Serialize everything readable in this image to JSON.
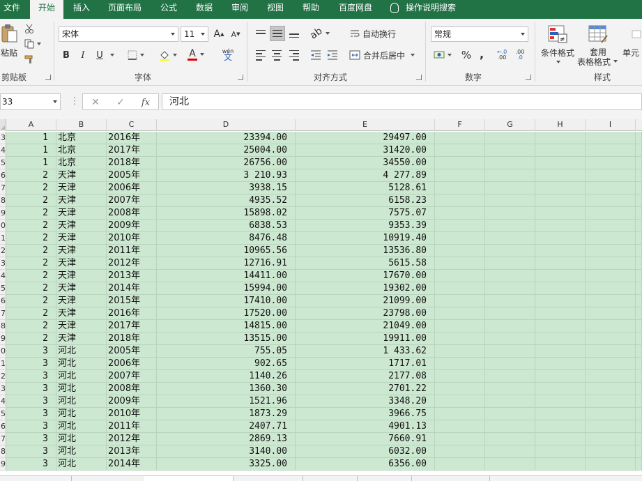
{
  "menu": {
    "tabs": [
      {
        "label": "文件"
      },
      {
        "label": "开始"
      },
      {
        "label": "插入"
      },
      {
        "label": "页面布局"
      },
      {
        "label": "公式"
      },
      {
        "label": "数据"
      },
      {
        "label": "审阅"
      },
      {
        "label": "视图"
      },
      {
        "label": "帮助"
      },
      {
        "label": "百度网盘"
      }
    ],
    "active": "开始",
    "tell_me": "操作说明搜索"
  },
  "ribbon": {
    "clipboard": {
      "paste_label": "粘贴",
      "group_label": "剪贴板"
    },
    "font": {
      "family": "宋体",
      "size": "11",
      "bold": "B",
      "italic": "I",
      "underline": "U",
      "font_color_letter": "A",
      "phonetic": "wén",
      "phonetic_char": "文",
      "grow": "A",
      "shrink": "A",
      "group_label": "字体"
    },
    "alignment": {
      "wrap_text": "自动换行",
      "merge_center": "合并后居中",
      "group_label": "对齐方式"
    },
    "number": {
      "format": "常规",
      "percent": "%",
      "comma": ",",
      "inc_decimal": ".00",
      "dec_decimal": ".0",
      "group_label": "数字"
    },
    "styles": {
      "conditional_format": "条件格式",
      "table_format_1": "套用",
      "table_format_2": "表格格式",
      "cell_styles": "单元",
      "group_label": "样式"
    }
  },
  "formula_bar": {
    "name_box": "33",
    "cancel": "✕",
    "enter": "✓",
    "fx": "fx",
    "value": "河北"
  },
  "sheet": {
    "columns": [
      "A",
      "B",
      "C",
      "D",
      "E",
      "F",
      "G",
      "H",
      "I"
    ],
    "row_numbers": [
      "3",
      "4",
      "5",
      "6",
      "7",
      "8",
      "9",
      "0",
      "1",
      "2",
      "3",
      "4",
      "5",
      "6",
      "7",
      "8",
      "9",
      "0",
      "1",
      "2",
      "3",
      "4",
      "5",
      "6",
      "7",
      "8",
      "9"
    ],
    "rows": [
      {
        "a": "1",
        "b": "北京",
        "c": "2016年",
        "d": "23394.00",
        "e": "29497.00"
      },
      {
        "a": "1",
        "b": "北京",
        "c": "2017年",
        "d": "25004.00",
        "e": "31420.00"
      },
      {
        "a": "1",
        "b": "北京",
        "c": "2018年",
        "d": "26756.00",
        "e": "34550.00"
      },
      {
        "a": "2",
        "b": "天津",
        "c": "2005年",
        "d": "3 210.93",
        "e": "4 277.89"
      },
      {
        "a": "2",
        "b": "天津",
        "c": "2006年",
        "d": "3938.15",
        "e": "5128.61"
      },
      {
        "a": "2",
        "b": "天津",
        "c": "2007年",
        "d": "4935.52",
        "e": "6158.23"
      },
      {
        "a": "2",
        "b": "天津",
        "c": "2008年",
        "d": "15898.02",
        "e": "7575.07"
      },
      {
        "a": "2",
        "b": "天津",
        "c": "2009年",
        "d": "6838.53",
        "e": "9353.39"
      },
      {
        "a": "2",
        "b": "天津",
        "c": "2010年",
        "d": "8476.48",
        "e": "10919.40"
      },
      {
        "a": "2",
        "b": "天津",
        "c": "2011年",
        "d": "10965.56",
        "e": "13536.80"
      },
      {
        "a": "2",
        "b": "天津",
        "c": "2012年",
        "d": "12716.91",
        "e": "5615.58"
      },
      {
        "a": "2",
        "b": "天津",
        "c": "2013年",
        "d": "14411.00",
        "e": "17670.00"
      },
      {
        "a": "2",
        "b": "天津",
        "c": "2014年",
        "d": "15994.00",
        "e": "19302.00"
      },
      {
        "a": "2",
        "b": "天津",
        "c": "2015年",
        "d": "17410.00",
        "e": "21099.00"
      },
      {
        "a": "2",
        "b": "天津",
        "c": "2016年",
        "d": "17520.00",
        "e": "23798.00"
      },
      {
        "a": "2",
        "b": "天津",
        "c": "2017年",
        "d": "14815.00",
        "e": "21049.00"
      },
      {
        "a": "2",
        "b": "天津",
        "c": "2018年",
        "d": "13515.00",
        "e": "19911.00"
      },
      {
        "a": "3",
        "b": "河北",
        "c": "2005年",
        "d": "755.05",
        "e": "1 433.62"
      },
      {
        "a": "3",
        "b": "河北",
        "c": "2006年",
        "d": "902.65",
        "e": "1717.01"
      },
      {
        "a": "3",
        "b": "河北",
        "c": "2007年",
        "d": "1140.26",
        "e": "2177.08"
      },
      {
        "a": "3",
        "b": "河北",
        "c": "2008年",
        "d": "1360.30",
        "e": "2701.22"
      },
      {
        "a": "3",
        "b": "河北",
        "c": "2009年",
        "d": "1521.96",
        "e": "3348.20"
      },
      {
        "a": "3",
        "b": "河北",
        "c": "2010年",
        "d": "1873.29",
        "e": "3966.75"
      },
      {
        "a": "3",
        "b": "河北",
        "c": "2011年",
        "d": "2407.71",
        "e": "4901.13"
      },
      {
        "a": "3",
        "b": "河北",
        "c": "2012年",
        "d": "2869.13",
        "e": "7660.91"
      },
      {
        "a": "3",
        "b": "河北",
        "c": "2013年",
        "d": "3140.00",
        "e": "6032.00"
      },
      {
        "a": "3",
        "b": "河北",
        "c": "2014年",
        "d": "3325.00",
        "e": "6356.00"
      }
    ]
  },
  "colors": {
    "brand": "#217346",
    "cell_fill": "#cde8d1"
  }
}
